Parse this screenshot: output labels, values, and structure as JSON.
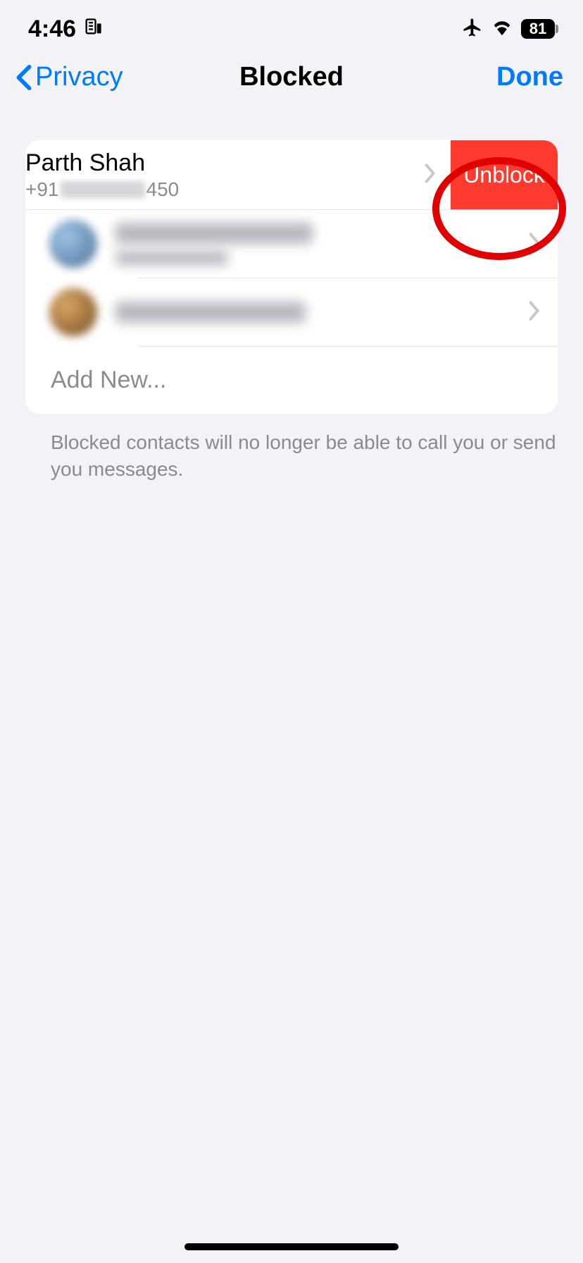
{
  "status_bar": {
    "time": "4:46",
    "battery_percent": "81"
  },
  "nav": {
    "back_label": "Privacy",
    "title": "Blocked",
    "done_label": "Done"
  },
  "blocked_list": {
    "swiped_contact": {
      "name": "Parth Shah",
      "phone_prefix": "+91",
      "phone_suffix": "450",
      "unblock_label": "Unblock"
    },
    "add_new_label": "Add New..."
  },
  "footer_note": "Blocked contacts will no longer be able to call you or send you messages."
}
